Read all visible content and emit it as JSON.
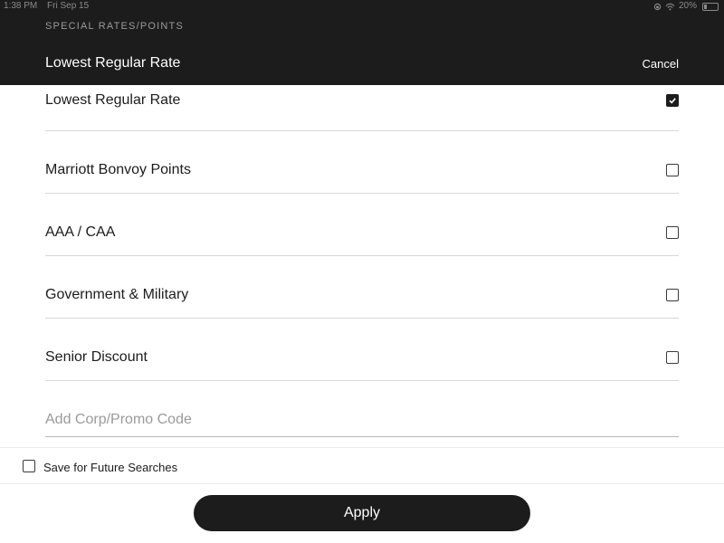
{
  "status_bar": {
    "time": "1:38 PM",
    "date": "Fri Sep 15",
    "battery": "20%"
  },
  "header": {
    "eyebrow": "SPECIAL RATES/POINTS",
    "title": "Lowest Regular Rate",
    "cancel_label": "Cancel"
  },
  "options": [
    {
      "label": "Lowest Regular Rate",
      "checked": true
    },
    {
      "label": "Marriott Bonvoy Points",
      "checked": false
    },
    {
      "label": "AAA / CAA",
      "checked": false
    },
    {
      "label": "Government & Military",
      "checked": false
    },
    {
      "label": "Senior Discount",
      "checked": false
    }
  ],
  "promo": {
    "placeholder": "Add Corp/Promo Code",
    "value": ""
  },
  "save": {
    "label": "Save for Future Searches",
    "checked": false
  },
  "apply_label": "Apply",
  "colors": {
    "header_bg": "#1c1c1c",
    "button_bg": "#1c1c1c",
    "divider": "#d8d8d8"
  }
}
